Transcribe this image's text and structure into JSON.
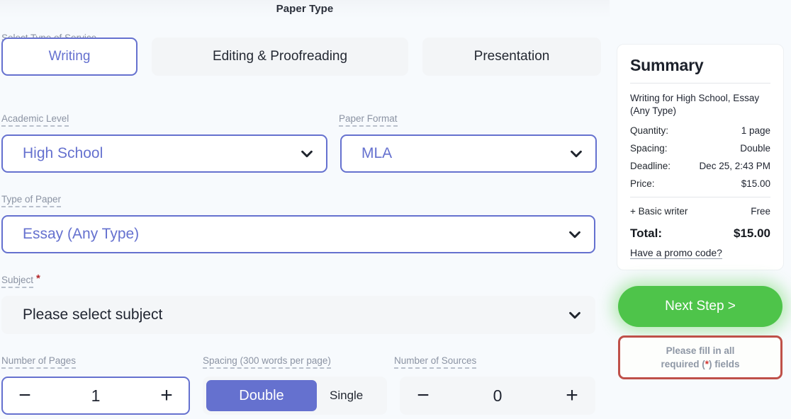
{
  "header": {
    "title": "Paper Type"
  },
  "service": {
    "label": "Select Type of Service",
    "options": [
      {
        "label": "Writing",
        "selected": true
      },
      {
        "label": "Editing & Proofreading",
        "selected": false
      },
      {
        "label": "Presentation",
        "selected": false
      }
    ]
  },
  "academic_level": {
    "label": "Academic Level",
    "value": "High School"
  },
  "paper_format": {
    "label": "Paper Format",
    "value": "MLA"
  },
  "type_of_paper": {
    "label": "Type of Paper",
    "value": "Essay (Any Type)"
  },
  "subject": {
    "label": "Subject",
    "required_marker": "*",
    "value": "Please select subject"
  },
  "pages": {
    "label": "Number of Pages",
    "value": "1",
    "minus": "−",
    "plus": "+"
  },
  "spacing": {
    "label": "Spacing (300 words per page)",
    "selected": "Double",
    "options": [
      "Double",
      "Single"
    ]
  },
  "sources": {
    "label": "Number of Sources",
    "value": "0",
    "minus": "−",
    "plus": "+"
  },
  "summary": {
    "title": "Summary",
    "description": "Writing for High School, Essay (Any Type)",
    "rows": [
      {
        "key": "Quantity:",
        "value": "1 page"
      },
      {
        "key": "Spacing:",
        "value": "Double"
      },
      {
        "key": "Deadline:",
        "value": "Dec 25, 2:43 PM"
      },
      {
        "key": "Price:",
        "value": "$15.00"
      }
    ],
    "extra": {
      "key": "+ Basic writer",
      "value": "Free"
    },
    "total": {
      "key": "Total:",
      "value": "$15.00"
    },
    "promo": "Have a promo code?"
  },
  "actions": {
    "next_label": "Next Step >",
    "warning_line1": "Please fill in all",
    "warning_line2_a": "required (",
    "warning_star": "*",
    "warning_line2_b": ") fields"
  },
  "colors": {
    "accent": "#6571cf",
    "green": "#4ec44a",
    "red": "#bf5049",
    "background": "#f7fafd"
  }
}
